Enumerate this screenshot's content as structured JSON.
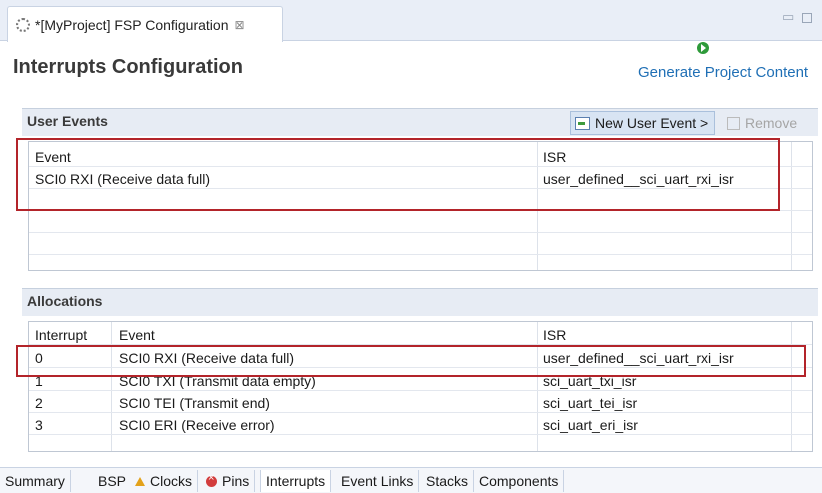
{
  "editor_tab": {
    "title": "*[MyProject] FSP Configuration",
    "close": "⊠"
  },
  "header": {
    "title": "Interrupts Configuration",
    "generate_label": "Generate Project Content"
  },
  "user_events": {
    "title": "User Events",
    "new_button": "New User Event >",
    "remove_button": "Remove",
    "columns": [
      "Event",
      "ISR"
    ],
    "rows": [
      {
        "event": "SCI0 RXI (Receive data full)",
        "isr": "user_defined__sci_uart_rxi_isr"
      }
    ]
  },
  "allocations": {
    "title": "Allocations",
    "columns": [
      "Interrupt",
      "Event",
      "ISR"
    ],
    "rows": [
      {
        "interrupt": "0",
        "event": "SCI0 RXI (Receive data full)",
        "isr": "user_defined__sci_uart_rxi_isr"
      },
      {
        "interrupt": "1",
        "event": "SCI0 TXI (Transmit data empty)",
        "isr": "sci_uart_txi_isr"
      },
      {
        "interrupt": "2",
        "event": "SCI0 TEI (Transmit end)",
        "isr": "sci_uart_tei_isr"
      },
      {
        "interrupt": "3",
        "event": "SCI0 ERI (Receive error)",
        "isr": "sci_uart_eri_isr"
      }
    ]
  },
  "bottom_tabs": [
    "Summary",
    "BSP",
    "Clocks",
    "Pins",
    "Interrupts",
    "Event Links",
    "Stacks",
    "Components"
  ],
  "colors": {
    "accent": "#1f6fb5",
    "highlight": "#b3242a",
    "warning": "#e3a21a",
    "error": "#d23c3c"
  }
}
